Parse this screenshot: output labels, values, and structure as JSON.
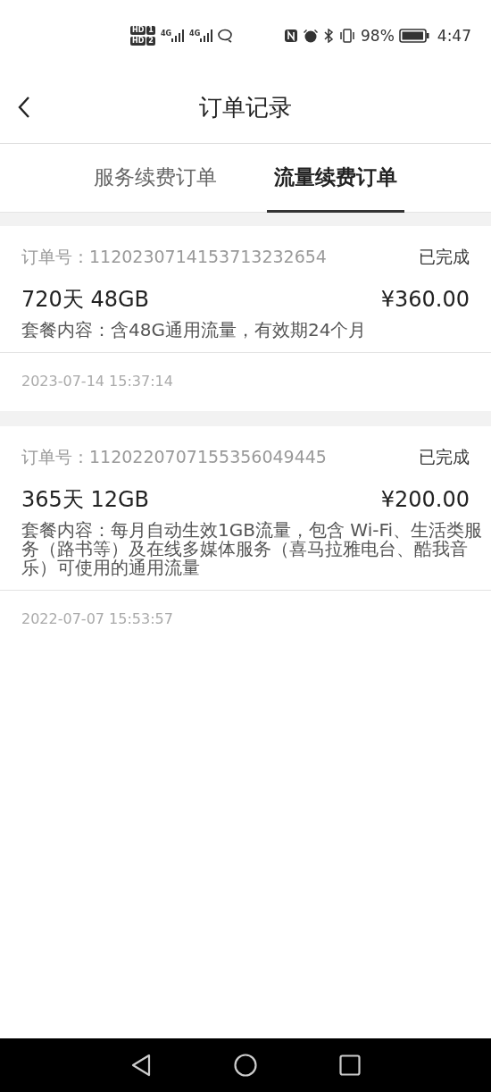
{
  "status_bar": {
    "sims": [
      {
        "badge": "HD",
        "slot": "1",
        "network": "4G"
      },
      {
        "badge": "HD",
        "slot": "2",
        "network": "4G"
      }
    ],
    "battery": "98%",
    "time": "4:47"
  },
  "header": {
    "title": "订单记录"
  },
  "tabs": [
    {
      "label": "服务续费订单",
      "selected": false
    },
    {
      "label": "流量续费订单",
      "selected": true
    }
  ],
  "orders": [
    {
      "order_label": "订单号：",
      "order_no": "1120230714153713232654",
      "status": "已完成",
      "plan": "720天 48GB",
      "price": "¥360.00",
      "content": "套餐内容：含48G通用流量，有效期24个月",
      "date": "2023-07-14 15:37:14"
    },
    {
      "order_label": "订单号：",
      "order_no": "1120220707155356049445",
      "status": "已完成",
      "plan": "365天 12GB",
      "price": "¥200.00",
      "content": "套餐内容：每月自动生效1GB流量，包含 Wi-Fi、生活类服务（路书等）及在线多媒体服务（喜马拉雅电台、酷我音乐）可使用的通用流量",
      "date": "2022-07-07 15:53:57"
    }
  ]
}
